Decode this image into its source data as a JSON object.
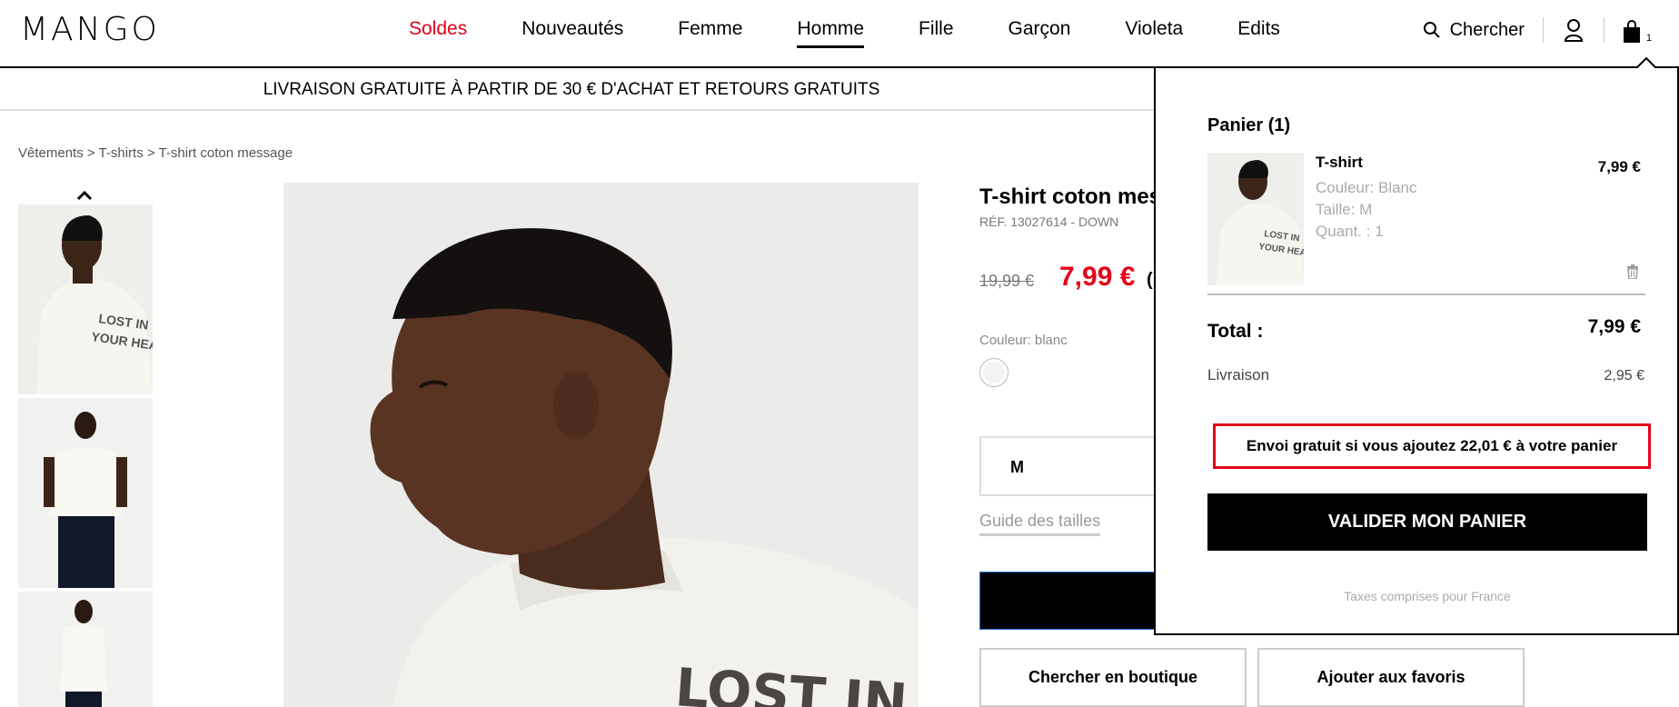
{
  "brand": "MANGO",
  "nav": {
    "items": [
      "Soldes",
      "Nouveautés",
      "Femme",
      "Homme",
      "Fille",
      "Garçon",
      "Violeta",
      "Edits"
    ]
  },
  "header": {
    "search_label": "Chercher",
    "bag_count": "1"
  },
  "promo": "LIVRAISON GRATUITE À PARTIR DE 30 € D'ACHAT ET RETOURS GRATUITS",
  "breadcrumb": "Vêtements > T-shirts > T-shirt coton message",
  "product": {
    "title": "T-shirt coton mes",
    "ref": "RÉF. 13027614 - DOWN",
    "old_price": "19,99 €",
    "new_price": "7,99 €",
    "paren": "(",
    "color_label": "Couleur: blanc",
    "size": "M",
    "size_guide": "Guide des tailles",
    "find_in_store": "Chercher en boutique",
    "add_favorites": "Ajouter aux favoris"
  },
  "cart": {
    "title": "Panier (1)",
    "item": {
      "name": "T-shirt",
      "color": "Couleur: Blanc",
      "size": "Taille: M",
      "qty": "Quant. : 1",
      "price": "7,99 €"
    },
    "total_label": "Total :",
    "total_value": "7,99 €",
    "shipping_label": "Livraison",
    "shipping_value": "2,95 €",
    "free_shipping_msg": "Envoi gratuit si vous ajoutez 22,01 € à votre panier",
    "validate_label": "VALIDER MON PANIER",
    "taxes_note": "Taxes comprises pour France"
  },
  "colors": {
    "sale_red": "#e3001b",
    "black": "#000000"
  }
}
